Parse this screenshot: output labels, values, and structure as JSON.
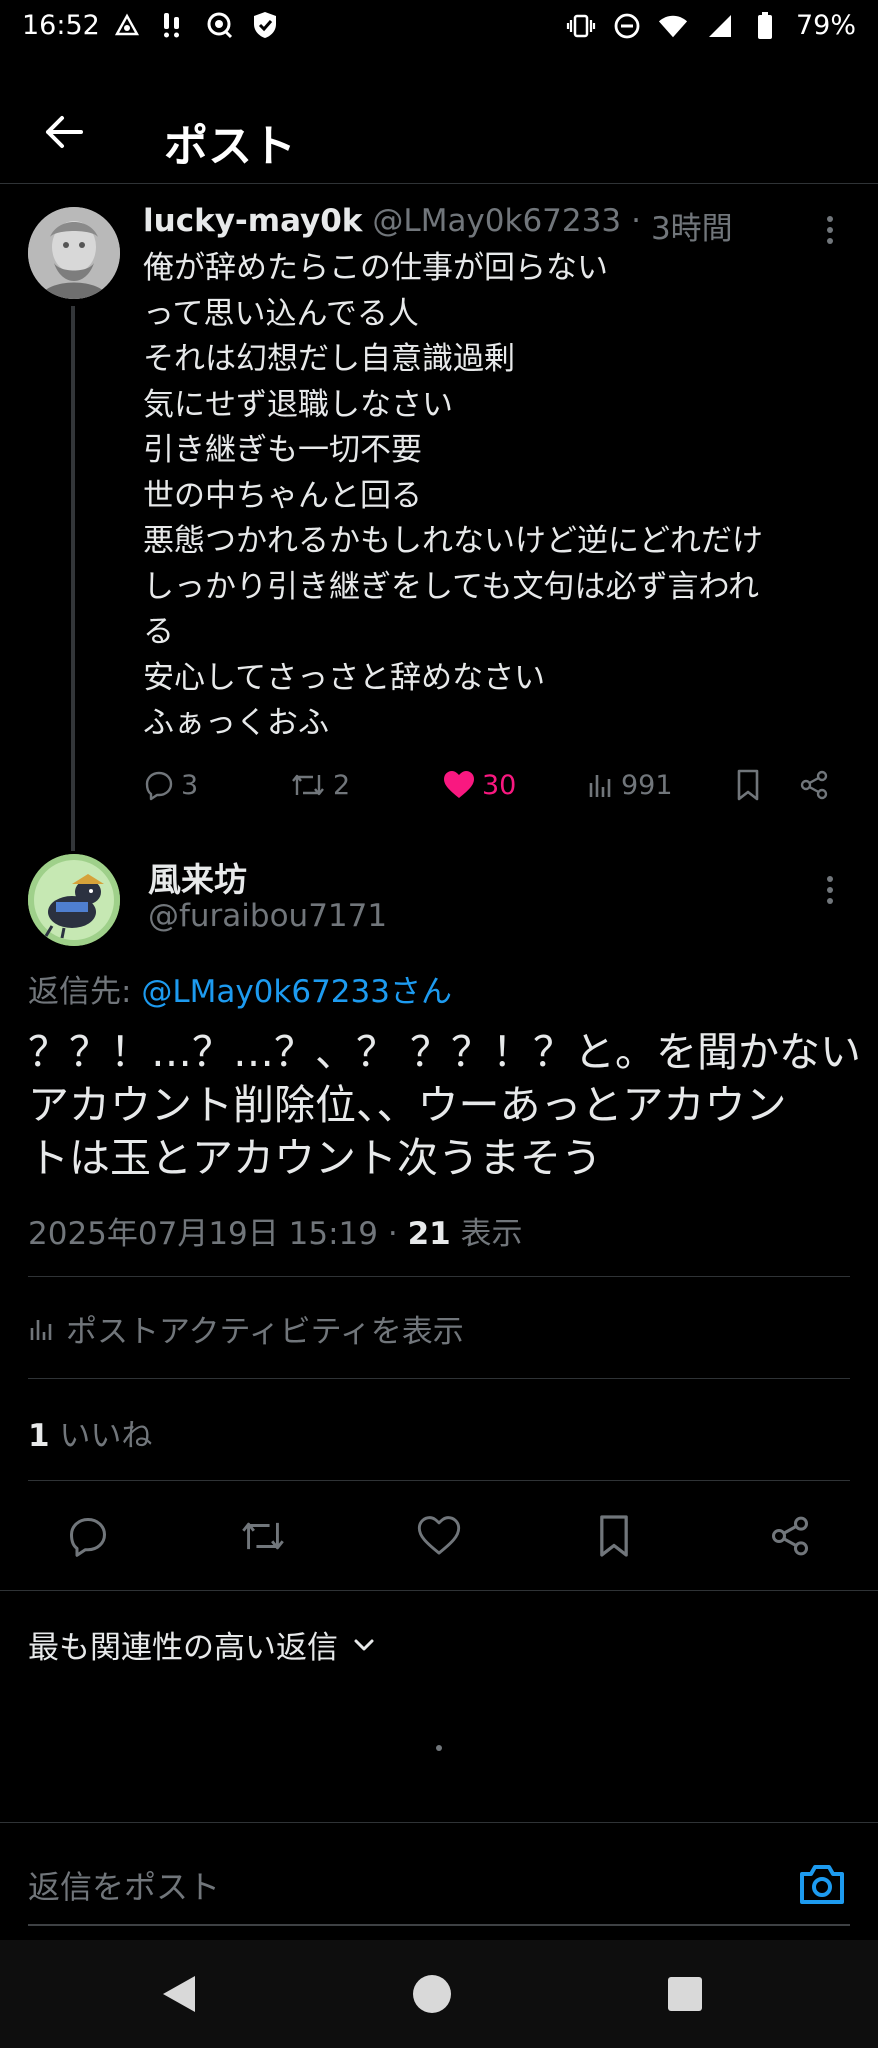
{
  "status_bar": {
    "time": "16:52",
    "battery": "79%"
  },
  "header": {
    "title": "ポスト"
  },
  "parent_post": {
    "name": "lucky-may0k",
    "handle": "@LMay0k67233",
    "separator": "·",
    "time": "3時間",
    "lines": [
      "俺が辞めたらこの仕事が回らない",
      "って思い込んでる人",
      "それは幻想だし自意識過剰",
      "気にせず退職しなさい",
      "引き継ぎも一切不要",
      "世の中ちゃんと回る",
      "悪態つかれるかもしれないけど逆にどれだけ",
      "しっかり引き継ぎをしても文句は必ず言われ",
      "る",
      "安心してさっさと辞めなさい",
      "ふぁっくおふ"
    ],
    "replies": "3",
    "reposts": "2",
    "likes": "30",
    "views": "991",
    "like_color": "#f91880"
  },
  "focus_post": {
    "name": "風来坊",
    "handle": "@furaibou7171",
    "reply_to_prefix": "返信先: ",
    "reply_to_mention": "@LMay0k67233さん",
    "lines": [
      "？？！…？…？、？ ？？！？と。を聞かない",
      "アカウント削除位、、ウーあっとアカウン",
      "トは玉とアカウント次うまそう"
    ],
    "timestamp": "2025年07月19日 15:19",
    "separator": "·",
    "views_count": "21",
    "views_label": " 表示",
    "activity_label": "ポストアクティビティを表示",
    "likes_count": "1",
    "likes_label": " いいね"
  },
  "replies_section": {
    "sort_label": "最も関連性の高い返信"
  },
  "composer": {
    "placeholder": "返信をポスト",
    "accent_color": "#1d9bf0"
  }
}
